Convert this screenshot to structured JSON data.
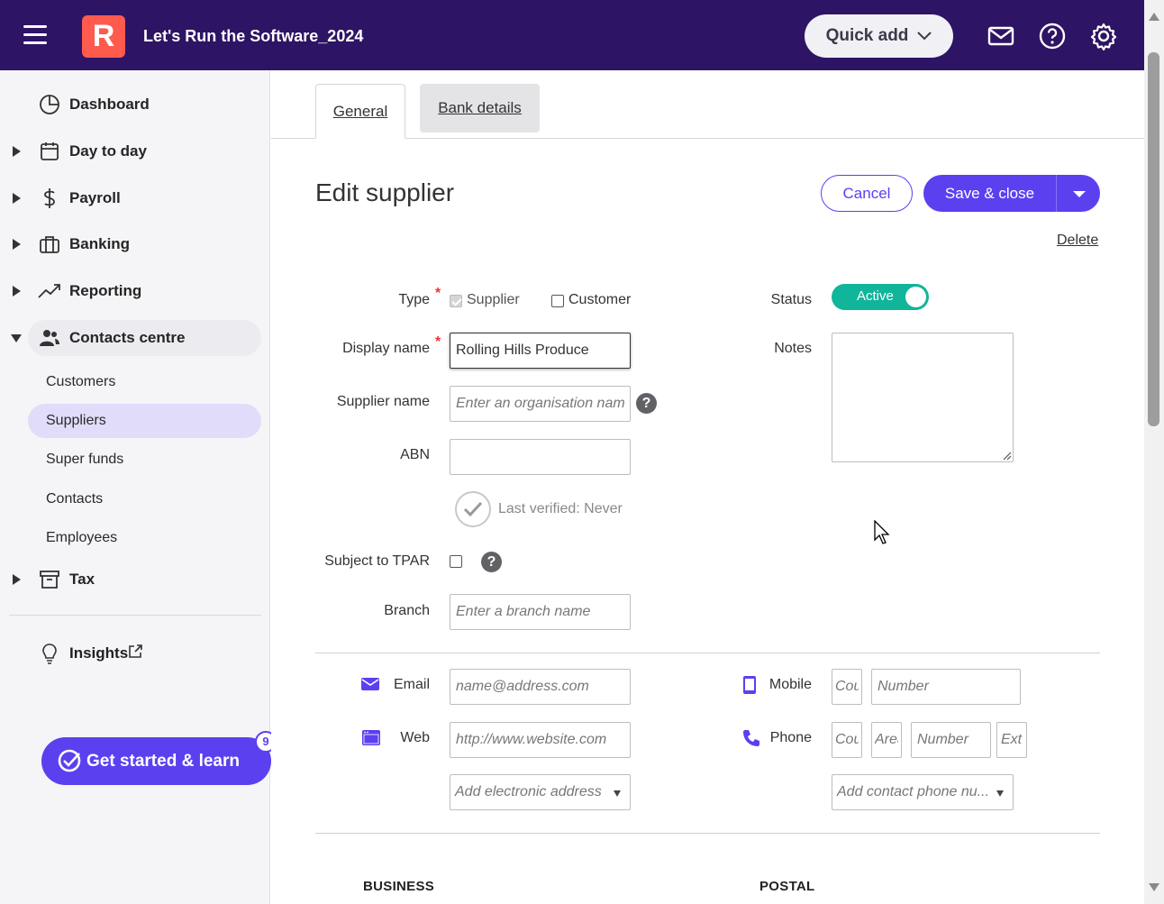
{
  "header": {
    "logo_letter": "R",
    "app_title": "Let's Run the Software_2024",
    "quick_add_label": "Quick add",
    "brand_color": "#2e1464",
    "logo_color": "#ff5a4e"
  },
  "sidebar": {
    "items": [
      {
        "label": "Dashboard",
        "icon": "pie-chart-icon"
      },
      {
        "label": "Day to day",
        "icon": "calendar-icon"
      },
      {
        "label": "Payroll",
        "icon": "dollar-icon"
      },
      {
        "label": "Banking",
        "icon": "briefcase-icon"
      },
      {
        "label": "Reporting",
        "icon": "trend-icon"
      },
      {
        "label": "Contacts centre",
        "icon": "people-icon"
      },
      {
        "label": "Tax",
        "icon": "archive-icon"
      }
    ],
    "sub_items": [
      "Customers",
      "Suppliers",
      "Super funds",
      "Contacts",
      "Employees"
    ],
    "active_sub_item": "Suppliers",
    "insights_label": "Insights",
    "get_started_label": "Get started & learn",
    "get_started_badge": "9",
    "accent_color": "#5b40f0"
  },
  "tabs": {
    "general": "General",
    "bank_details": "Bank details"
  },
  "page": {
    "title": "Edit supplier",
    "cancel_label": "Cancel",
    "save_label": "Save & close",
    "delete_label": "Delete"
  },
  "form": {
    "type_label": "Type",
    "type_supplier": "Supplier",
    "type_customer": "Customer",
    "required_mark": "*",
    "status_label": "Status",
    "status_value": "Active",
    "status_color": "#10b59a",
    "display_name_label": "Display name",
    "display_name_value": "Rolling Hills Produce",
    "notes_label": "Notes",
    "supplier_name_label": "Supplier name",
    "supplier_name_placeholder": "Enter an organisation name",
    "abn_label": "ABN",
    "last_verified": "Last verified: Never",
    "tpar_label": "Subject to TPAR",
    "branch_label": "Branch",
    "branch_placeholder": "Enter a branch name",
    "help_glyph": "?"
  },
  "contact": {
    "email_label": "Email",
    "email_placeholder": "name@address.com",
    "web_label": "Web",
    "web_placeholder": "http://www.website.com",
    "add_electronic": "Add electronic address",
    "mobile_label": "Mobile",
    "mobile_country_placeholder": "Cou",
    "mobile_number_placeholder": "Number",
    "phone_label": "Phone",
    "phone_country_placeholder": "Cou",
    "phone_area_placeholder": "Area",
    "phone_number_placeholder": "Number",
    "phone_ext_placeholder": "Ext",
    "add_phone": "Add contact phone nu..."
  },
  "address": {
    "business_heading": "BUSINESS",
    "postal_heading": "POSTAL"
  }
}
